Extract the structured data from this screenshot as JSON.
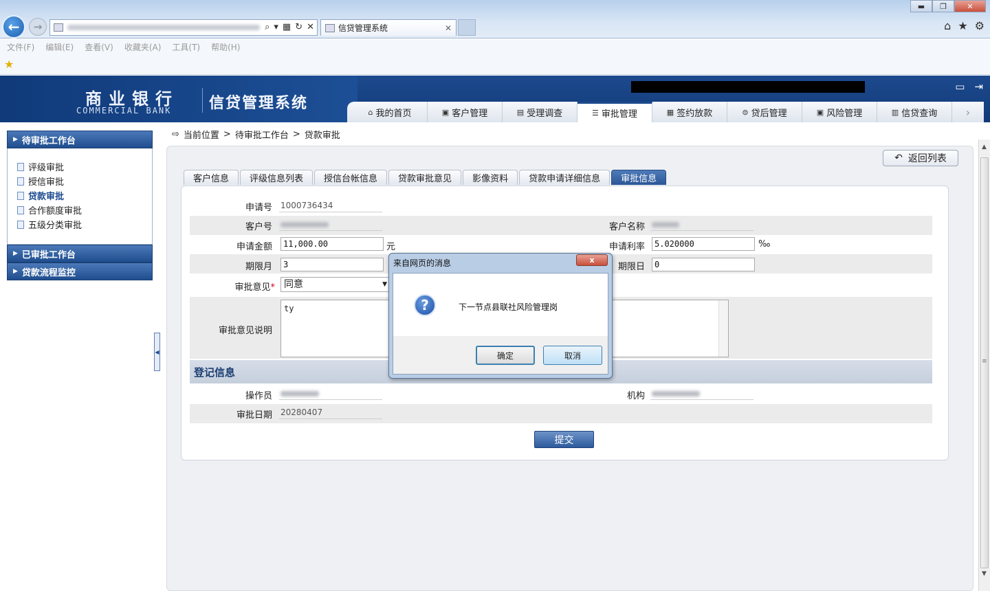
{
  "browser": {
    "tab_title": "信贷管理系统",
    "menu": [
      "文件(F)",
      "编辑(E)",
      "查看(V)",
      "收藏夹(A)",
      "工具(T)",
      "帮助(H)"
    ]
  },
  "header": {
    "bank_name_cn": "商业银行",
    "bank_name_en": "COMMERCIAL BANK",
    "system_title": "信贷管理系统",
    "nav_tabs": [
      "我的首页",
      "客户管理",
      "受理调查",
      "审批管理",
      "签约放款",
      "贷后管理",
      "风险管理",
      "信贷查询"
    ],
    "active_tab": "审批管理"
  },
  "sidebar": {
    "pending": {
      "title": "待审批工作台",
      "items": [
        "评级审批",
        "授信审批",
        "贷款审批",
        "合作额度审批",
        "五级分类审批"
      ],
      "active_item": "贷款审批"
    },
    "approved_title": "已审批工作台",
    "monitor_title": "贷款流程监控"
  },
  "breadcrumb": {
    "prefix": "当前位置",
    "sep": ">",
    "level1": "待审批工作台",
    "level2": "贷款审批"
  },
  "actions": {
    "return_label": "返回列表",
    "submit_label": "提交"
  },
  "subtabs": [
    "客户信息",
    "评级信息列表",
    "授信台帐信息",
    "贷款审批意见",
    "影像资料",
    "贷款申请详细信息",
    "审批信息"
  ],
  "form": {
    "app_no_label": "申请号",
    "app_no": "1000736434",
    "customer_no_label": "客户号",
    "customer_name_label": "客户名称",
    "amount_label": "申请金额",
    "amount": "11,000.00",
    "amount_unit": "元",
    "rate_label": "申请利率",
    "rate": "5.020000",
    "rate_unit": "‰",
    "term_month_label": "期限月",
    "term_month": "3",
    "term_day_label": "期限日",
    "term_day": "0",
    "opinion_label": "审批意见",
    "opinion_required": "*",
    "opinion": "同意",
    "opinion_desc_label": "审批意见说明",
    "opinion_desc": "ty"
  },
  "register": {
    "title": "登记信息",
    "operator_label": "操作员",
    "org_label": "机构",
    "date_label": "审批日期",
    "date": "20280407"
  },
  "dialog": {
    "title": "来自网页的消息",
    "close_label": "x",
    "message": "下一节点县联社风险管理岗",
    "ok_label": "确定",
    "cancel_label": "取消"
  }
}
